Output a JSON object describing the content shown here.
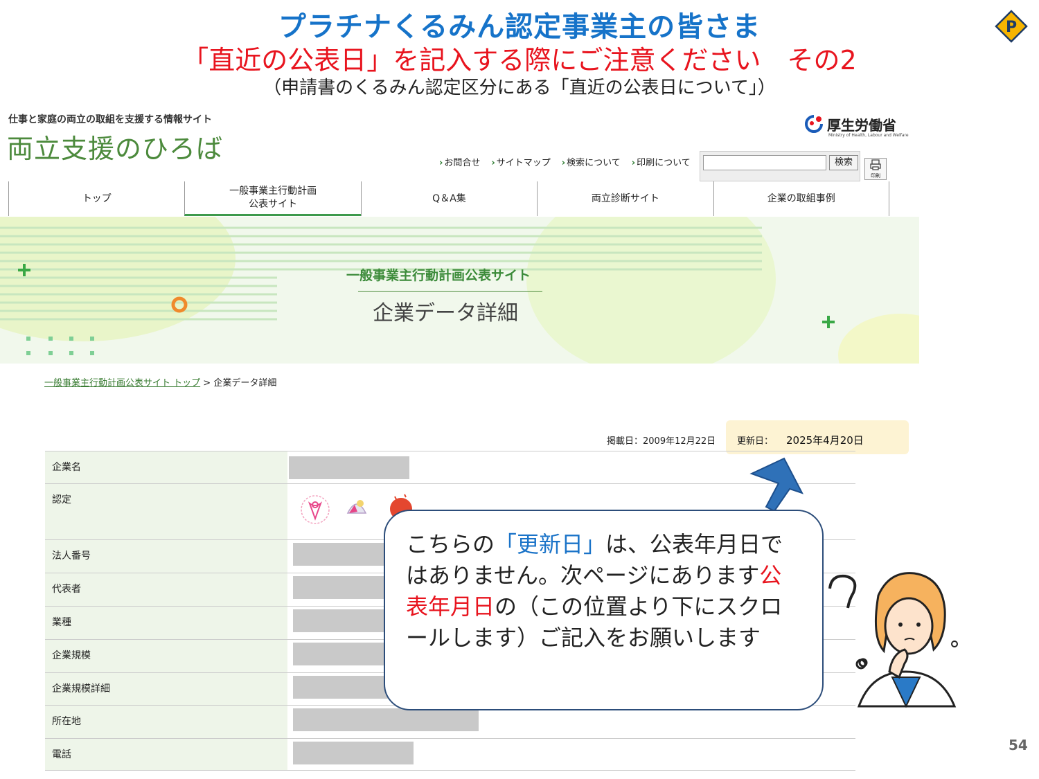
{
  "slide": {
    "title_line1": "プラチナくるみん認定事業主の皆さま",
    "title_line2": "「直近の公表日」を記入する際にご注意ください　その2",
    "title_line3": "（申請書のくるみん認定区分にある「直近の公表日について」）",
    "badge_letter": "P",
    "page_number": "54"
  },
  "site": {
    "subtitle": "仕事と家庭の両立の取組を支援する情報サイト",
    "logo": "両立支援のひろば",
    "ministry_name": "厚生労働省",
    "ministry_small": "Ministry of Health, Labour and Welfare",
    "util_links": [
      "お問合せ",
      "サイトマップ",
      "検索について",
      "印刷について"
    ],
    "search_button": "検索",
    "print_label": "印刷",
    "nav": [
      {
        "label": "トップ",
        "active": false
      },
      {
        "label": "一般事業主行動計画\n公表サイト",
        "active": true
      },
      {
        "label": "Q＆A集",
        "active": false
      },
      {
        "label": "両立診断サイト",
        "active": false
      },
      {
        "label": "企業の取組事例",
        "active": false
      }
    ],
    "hero_title": "一般事業主行動計画公表サイト",
    "hero_subtitle": "企業データ詳細",
    "breadcrumb_link": "一般事業主行動計画公表サイト トップ",
    "breadcrumb_sep": " > ",
    "breadcrumb_current": "企業データ詳細"
  },
  "dates": {
    "posted": "掲載日：2009年12月22日",
    "updated_label": "更新日：",
    "updated_value": "2025年4月20日"
  },
  "table": {
    "rows": [
      "企業名",
      "認定",
      "法人番号",
      "代表者",
      "業種",
      "企業規模",
      "企業規模詳細",
      "所在地",
      "電話"
    ]
  },
  "callout": {
    "part1": "こちらの",
    "part2": "「更新日」",
    "part3": "は、公表年月日ではありません。次ページにあります",
    "part4": "公表年月日",
    "part5": "の（この位置より下にスクロールします）ご記入をお願いします"
  },
  "colors": {
    "title_blue": "#1673c9",
    "title_red": "#e8141e",
    "site_green": "#4c8a3c",
    "callout_border": "#2c4d7a",
    "arrow_blue": "#2f71b8",
    "highlight": "#fdf3d3"
  }
}
